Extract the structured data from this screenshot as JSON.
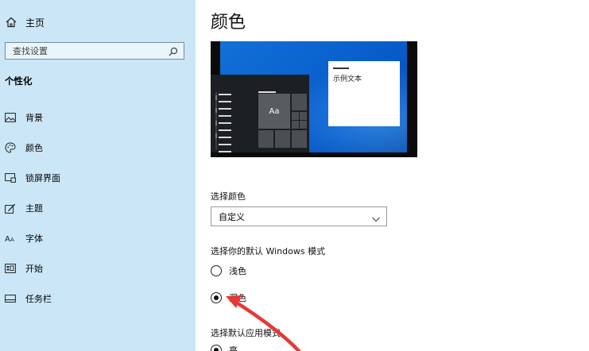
{
  "sidebar": {
    "home_label": "主页",
    "search_placeholder": "查找设置",
    "section_title": "个性化",
    "items": [
      {
        "label": "背景",
        "icon": "picture-icon"
      },
      {
        "label": "颜色",
        "icon": "palette-icon"
      },
      {
        "label": "锁屏界面",
        "icon": "lock-screen-icon"
      },
      {
        "label": "主题",
        "icon": "brush-icon"
      },
      {
        "label": "字体",
        "icon": "font-icon"
      },
      {
        "label": "开始",
        "icon": "start-icon"
      },
      {
        "label": "任务栏",
        "icon": "taskbar-icon"
      }
    ],
    "background_color": "#cbe6f7"
  },
  "main": {
    "title": "颜色",
    "preview": {
      "tile_text": "Aa",
      "sample_text": "示例文本"
    },
    "choose_color": {
      "label": "选择颜色",
      "selected": "自定义"
    },
    "windows_mode": {
      "label": "选择你的默认 Windows 模式",
      "options": [
        {
          "label": "浅色",
          "checked": false
        },
        {
          "label": "深色",
          "checked": true
        }
      ]
    },
    "app_mode": {
      "label": "选择默认应用模式",
      "options": [
        {
          "label": "亮",
          "checked": true
        }
      ]
    }
  },
  "annotation": {
    "arrow_color": "#e53935"
  }
}
